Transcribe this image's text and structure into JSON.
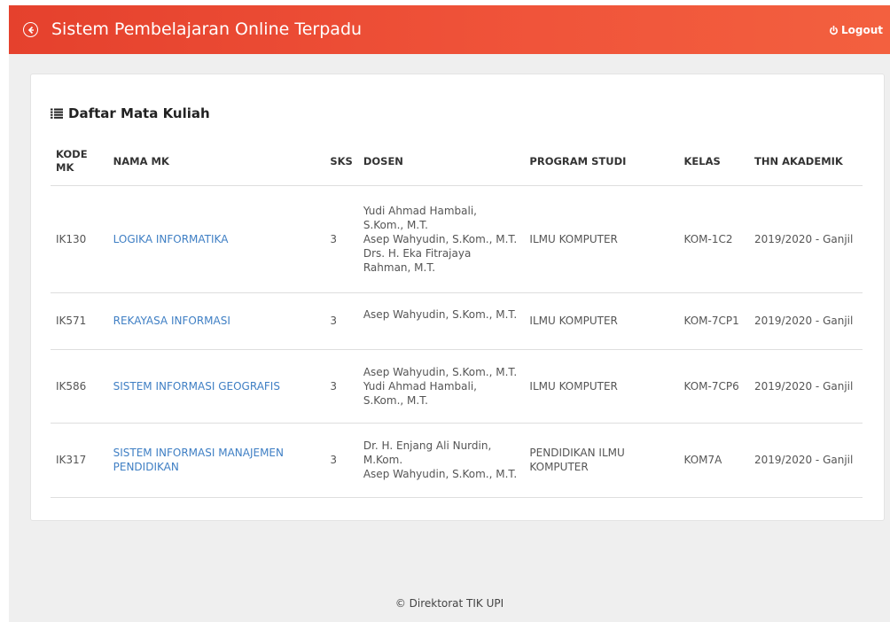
{
  "header": {
    "title": "Sistem Pembelajaran Online Terpadu",
    "logout_label": "Logout",
    "back_icon": "arrow-circle-left-icon",
    "logout_icon": "power-icon",
    "bar_color": "#ec4c35"
  },
  "card": {
    "title": "Daftar Mata Kuliah",
    "title_icon": "list-icon"
  },
  "table": {
    "columns": {
      "kode": "KODE MK",
      "nama": "NAMA MK",
      "sks": "SKS",
      "dosen": "DOSEN",
      "prodi": "PROGRAM STUDI",
      "kelas": "KELAS",
      "thn": "THN AKADEMIK"
    },
    "rows": [
      {
        "kode": "IK130",
        "nama": "LOGIKA INFORMATIKA",
        "sks": "3",
        "dosen": [
          "Yudi Ahmad Hambali, S.Kom., M.T.",
          "Asep Wahyudin, S.Kom., M.T.",
          "Drs. H. Eka Fitrajaya Rahman, M.T."
        ],
        "prodi": "ILMU KOMPUTER",
        "kelas": "KOM-1C2",
        "thn": "2019/2020 - Ganjil"
      },
      {
        "kode": "IK571",
        "nama": "REKAYASA INFORMASI",
        "sks": "3",
        "dosen": [
          "Asep Wahyudin, S.Kom., M.T."
        ],
        "prodi": "ILMU KOMPUTER",
        "kelas": "KOM-7CP1",
        "thn": "2019/2020 - Ganjil"
      },
      {
        "kode": "IK586",
        "nama": "SISTEM INFORMASI GEOGRAFIS",
        "sks": "3",
        "dosen": [
          "Asep Wahyudin, S.Kom., M.T.",
          "Yudi Ahmad Hambali, S.Kom., M.T."
        ],
        "prodi": "ILMU KOMPUTER",
        "kelas": "KOM-7CP6",
        "thn": "2019/2020 - Ganjil"
      },
      {
        "kode": "IK317",
        "nama": "SISTEM INFORMASI MANAJEMEN PENDIDIKAN",
        "sks": "3",
        "dosen": [
          "Dr. H. Enjang Ali Nurdin, M.Kom.",
          "Asep Wahyudin, S.Kom., M.T."
        ],
        "prodi": "PENDIDIKAN ILMU KOMPUTER",
        "kelas": "KOM7A",
        "thn": "2019/2020 - Ganjil"
      }
    ]
  },
  "footer": {
    "text": "© Direktorat TIK UPI"
  }
}
